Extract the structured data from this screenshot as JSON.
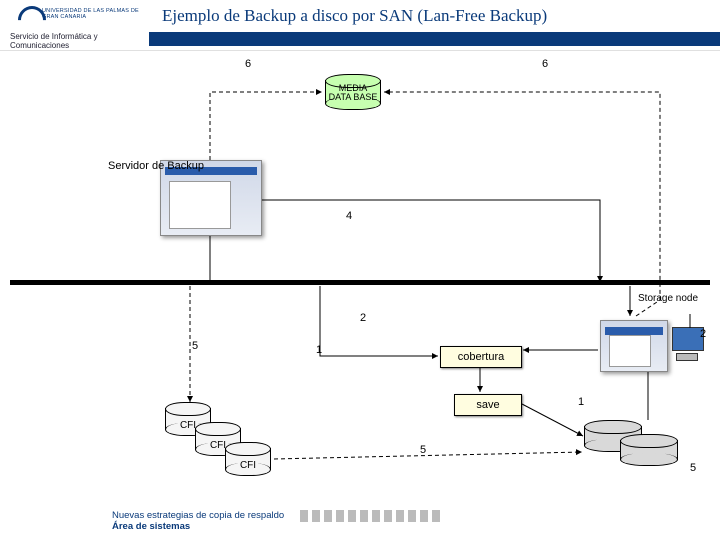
{
  "header": {
    "university": "UNIVERSIDAD DE LAS PALMAS DE GRAN CANARIA",
    "department": "Servicio de Informática y Comunicaciones",
    "title": "Ejemplo de Backup a disco por SAN (Lan-Free Backup)"
  },
  "nodes": {
    "media_db": "MEDIA\nDATA BASE",
    "backup_server": "Servidor\nde Backup",
    "storage_node": "Storage node",
    "cfi": "CFI",
    "cobertura": "cobertura",
    "save": "save"
  },
  "steps": {
    "top_left": "6",
    "top_right": "6",
    "mid_four": "4",
    "mid_two": "2",
    "five_left": "5",
    "one_left": "1",
    "one_right": "1",
    "five_bottom_mid": "5",
    "five_bottom_right": "5",
    "two_right": "2"
  },
  "footer": {
    "line1": "Nuevas estrategias de copia de respaldo",
    "line2": "Área de sistemas"
  }
}
